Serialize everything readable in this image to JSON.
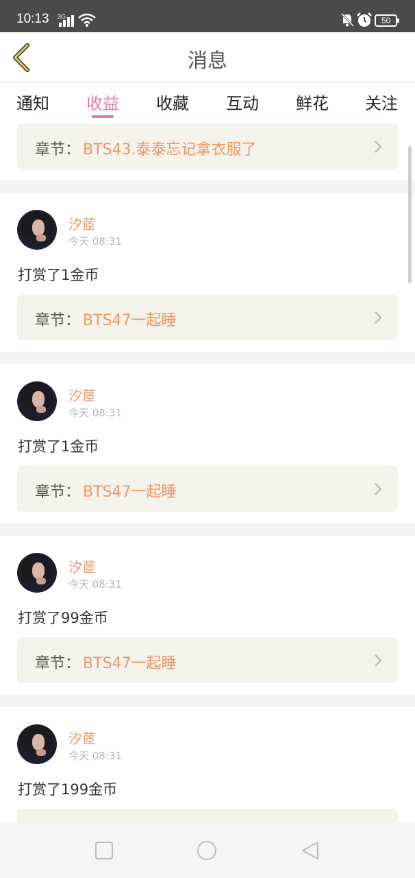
{
  "status_bar": {
    "time": "10:13",
    "network": "3G",
    "battery": "50"
  },
  "header": {
    "title": "消息"
  },
  "tabs": [
    {
      "label": "通知"
    },
    {
      "label": "收益"
    },
    {
      "label": "收藏"
    },
    {
      "label": "互动"
    },
    {
      "label": "鲜花"
    },
    {
      "label": "关注"
    }
  ],
  "active_tab": "收益",
  "colors": {
    "accent_pink": "#e27aa6",
    "accent_orange": "#ef9466",
    "username_orange": "#e99b71"
  },
  "feed": {
    "chapter_label": "章节：",
    "top_partial": {
      "chapter": "BTS43.泰泰忘记拿衣服了"
    },
    "items": [
      {
        "user": "汐茝",
        "time": "今天 08:31",
        "message": "打赏了1金币",
        "chapter": "BTS47一起睡"
      },
      {
        "user": "汐茝",
        "time": "今天 08:31",
        "message": "打赏了1金币",
        "chapter": "BTS47一起睡"
      },
      {
        "user": "汐茝",
        "time": "今天 08:31",
        "message": "打赏了99金币",
        "chapter": "BTS47一起睡"
      },
      {
        "user": "汐茝",
        "time": "今天 08:31",
        "message": "打赏了199金币"
      }
    ]
  }
}
